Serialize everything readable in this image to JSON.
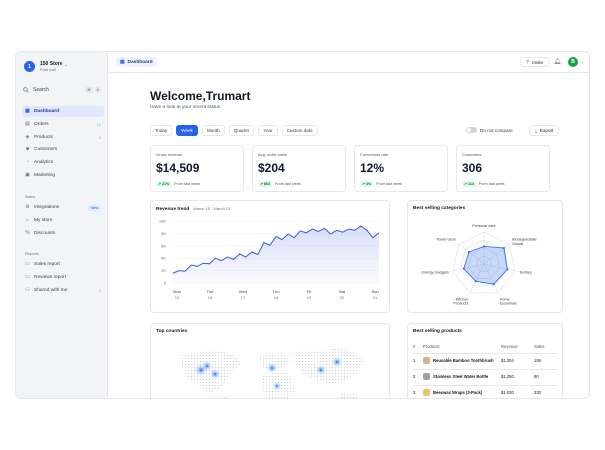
{
  "store": {
    "initial": "1",
    "name": "150 Store",
    "plan": "Free trail",
    "chevron": "chevron-down-icon"
  },
  "search": {
    "label": "Search",
    "keys": [
      "⌘",
      "K"
    ]
  },
  "nav": [
    {
      "label": "Dashboard",
      "icon": "grid-icon",
      "active": true,
      "count": ""
    },
    {
      "label": "Orders",
      "icon": "inbox-icon",
      "count": "12"
    },
    {
      "label": "Products",
      "icon": "tag-icon",
      "count": "3"
    },
    {
      "label": "Customers",
      "icon": "users-icon",
      "count": ""
    },
    {
      "label": "Analytics",
      "icon": "chart-icon",
      "count": ""
    },
    {
      "label": "Marketing",
      "icon": "megaphone-icon",
      "count": ""
    }
  ],
  "sales_section": {
    "label": "Sales",
    "items": [
      {
        "label": "Integrations",
        "icon": "plug-icon",
        "badge": "New"
      },
      {
        "label": "My store",
        "icon": "store-icon"
      },
      {
        "label": "Discounts",
        "icon": "discount-icon"
      }
    ]
  },
  "reports_section": {
    "label": "Reports",
    "items": [
      {
        "label": "Sales report",
        "icon": "file-icon",
        "count": ""
      },
      {
        "label": "Reviews report",
        "icon": "file-icon",
        "count": ""
      },
      {
        "label": "Shared with me",
        "icon": "share-icon",
        "count": "4"
      }
    ]
  },
  "topbar": {
    "breadcrumb": "Dashboard",
    "invite": "Invite",
    "avatar_initial": "B"
  },
  "header": {
    "title": "Welcome,Trumart",
    "subtitle": "Have a look at your recent status"
  },
  "period_tabs": [
    {
      "label": "Today"
    },
    {
      "label": "Week",
      "active": true
    },
    {
      "label": "Month"
    },
    {
      "label": "Quarter"
    },
    {
      "label": "Year"
    },
    {
      "label": "Custom date"
    }
  ],
  "compare_label": "Do not compare",
  "export_label": "Export",
  "kpis": [
    {
      "label": "Gross revenue",
      "value": "$14,509",
      "delta": "21%",
      "note": "From last week"
    },
    {
      "label": "Avg. order value",
      "value": "$204",
      "delta": "$63",
      "note": "From last week"
    },
    {
      "label": "Conversion rate",
      "value": "12%",
      "delta": "4%",
      "note": "From last week"
    },
    {
      "label": "Customers",
      "value": "306",
      "delta": "114",
      "note": "From last week"
    }
  ],
  "revenue_trend": {
    "title": "Revenue trend",
    "range": "March 15 - March 21",
    "chart_data": {
      "type": "area",
      "x_ticks": [
        {
          "day": "Mon",
          "date": "15"
        },
        {
          "day": "Tue",
          "date": "16"
        },
        {
          "day": "Wed",
          "date": "17"
        },
        {
          "day": "Thu",
          "date": "18"
        },
        {
          "day": "Fri",
          "date": "19"
        },
        {
          "day": "Sat",
          "date": "20"
        },
        {
          "day": "Sun",
          "date": "21"
        }
      ],
      "y_ticks": [
        "10K",
        "8K",
        "6K",
        "4K",
        "2K",
        "0"
      ],
      "ylim": [
        0,
        10000
      ],
      "values": [
        1600,
        2000,
        1900,
        2900,
        2700,
        3200,
        3100,
        4000,
        3600,
        4200,
        3800,
        4700,
        4200,
        5000,
        4600,
        6500,
        6100,
        7500,
        7000,
        7900,
        7300,
        8400,
        8100,
        8700,
        8300,
        8800,
        7900,
        8500,
        8200,
        8700,
        8500,
        9200,
        8500,
        7300,
        8100
      ],
      "color": "#3b5bdb"
    }
  },
  "best_categories": {
    "title": "Best selling categories",
    "chart_data": {
      "type": "radar",
      "axes": [
        "Personal care",
        "Biodegradable Goods",
        "Textiles",
        "Home Essentials",
        "Kitchen Products",
        "Energy Gadgets",
        "Travel Gear"
      ],
      "values": [
        0.55,
        0.8,
        0.75,
        0.7,
        0.6,
        0.65,
        0.6
      ],
      "color": "#2563eb"
    }
  },
  "top_countries": {
    "title": "Top countries"
  },
  "best_products": {
    "title": "Best selling products",
    "columns": [
      "#",
      "Products",
      "Revenue",
      "Sales"
    ],
    "rows": [
      {
        "rank": "1",
        "name": "Reusable Bamboo Toothbrush",
        "revenue": "$1,304",
        "sales": "195"
      },
      {
        "rank": "2",
        "name": "Stainless Steel Water Bottle",
        "revenue": "$1,250",
        "sales": "90"
      },
      {
        "rank": "3",
        "name": "Beeswax Wraps (3-Pack)",
        "revenue": "$1,030",
        "sales": "330"
      }
    ]
  }
}
